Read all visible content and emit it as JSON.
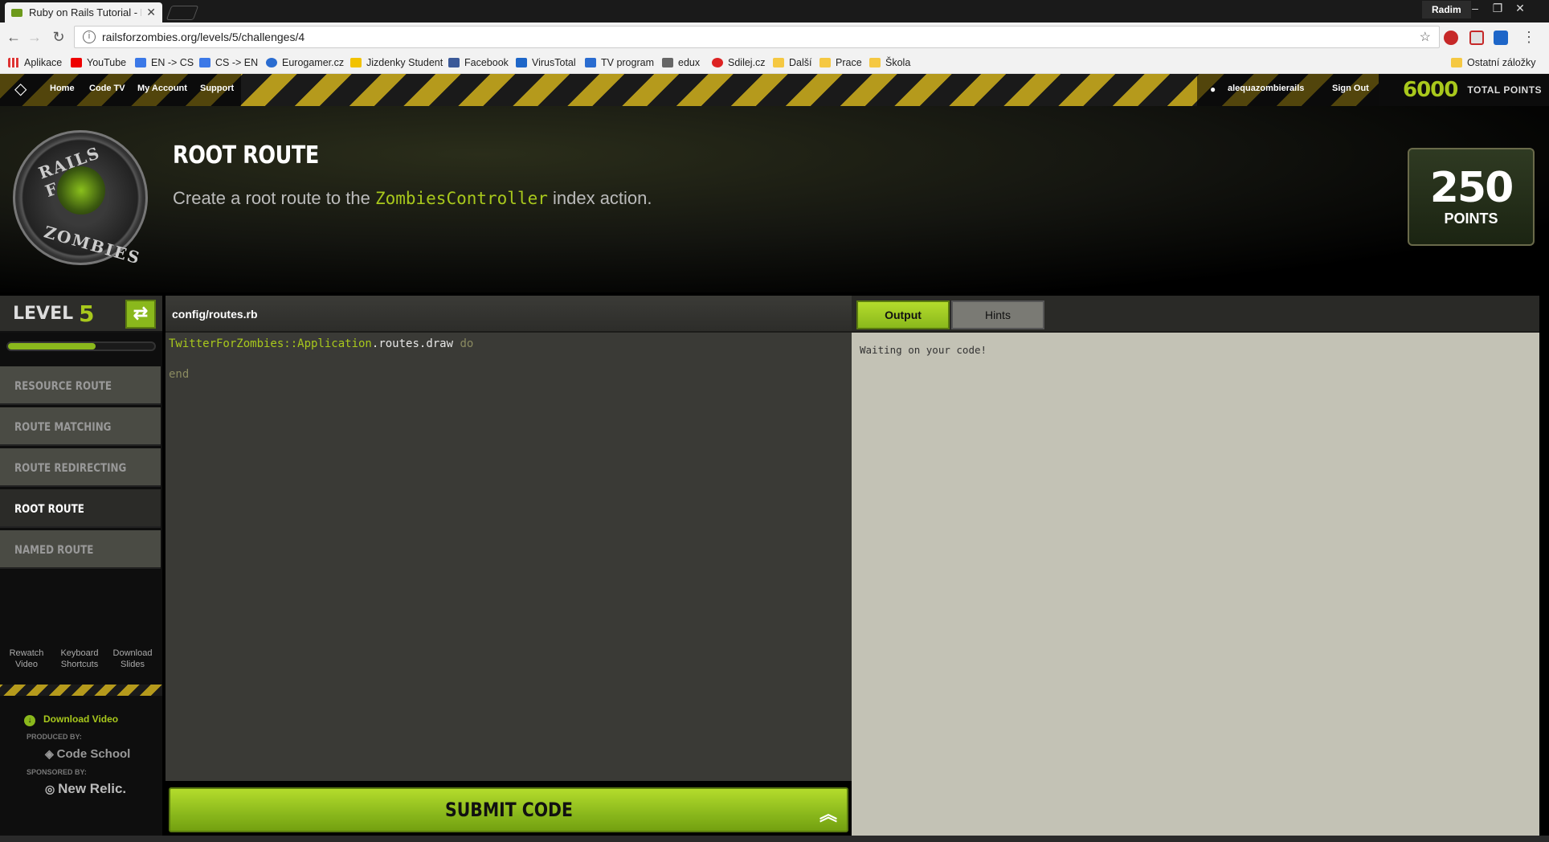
{
  "browser": {
    "tab_title": "Ruby on Rails Tutorial - F",
    "user": "Radim",
    "url": "railsforzombies.org/levels/5/challenges/4",
    "bookmarks": [
      "Aplikace",
      "YouTube",
      "EN -> CS",
      "CS -> EN",
      "Eurogamer.cz",
      "Jizdenky Student",
      "Facebook",
      "VirusTotal",
      "TV program",
      "edux",
      "Sdilej.cz",
      "Další",
      "Prace",
      "Škola"
    ],
    "other_bookmarks": "Ostatní záložky"
  },
  "site_nav": {
    "links": [
      "Home",
      "Code TV",
      "My Account",
      "Support"
    ],
    "username": "alequazombierails",
    "sign_out": "Sign Out",
    "total_points": "6000",
    "total_points_label": "TOTAL POINTS"
  },
  "logo": {
    "top": "RAILS FOR",
    "bottom": "ZOMBIES"
  },
  "challenge": {
    "title": "ROOT ROUTE",
    "desc_before": "Create a root route to the ",
    "desc_code": "ZombiesController",
    "desc_after": " index action.",
    "points": "250",
    "points_label": "POINTS"
  },
  "sidebar": {
    "level_label": "LEVEL",
    "level_number": "5",
    "progress": 0.6,
    "challenges": [
      {
        "label": "RESOURCE ROUTE",
        "active": false
      },
      {
        "label": "ROUTE MATCHING",
        "active": false
      },
      {
        "label": "ROUTE REDIRECTING",
        "active": false
      },
      {
        "label": "ROOT ROUTE",
        "active": true
      },
      {
        "label": "NAMED ROUTE",
        "active": false
      }
    ],
    "rewatch": "Rewatch\nVideo",
    "shortcuts": "Keyboard\nShortcuts",
    "slides": "Download\nSlides",
    "download_video": "Download Video",
    "produced_by_label": "PRODUCED BY:",
    "produced_by": "Code School",
    "sponsored_by_label": "SPONSORED BY:",
    "sponsored_by": "New Relic."
  },
  "editor": {
    "filename": "config/routes.rb",
    "line1_const": "TwitterForZombies::Application",
    "line1_dot": ".",
    "line1_call": "routes.draw",
    "line1_kw": "do",
    "line2": "end",
    "submit": "SUBMIT CODE"
  },
  "output": {
    "tab_output": "Output",
    "tab_hints": "Hints",
    "message": "Waiting on your code!"
  }
}
